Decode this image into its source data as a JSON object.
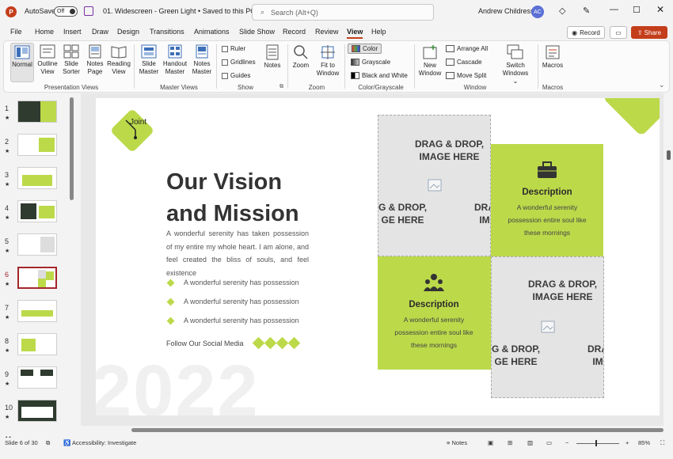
{
  "titlebar": {
    "autosave_label": "AutoSave",
    "autosave_state": "Off",
    "filename": "01. Widescreen - Green Light • Saved to this PC ⌄",
    "search_placeholder": "Search (Alt+Q)",
    "user_name": "Andrew Childress",
    "user_initials": "AC"
  },
  "menu": [
    "File",
    "Home",
    "Insert",
    "Draw",
    "Design",
    "Transitions",
    "Animations",
    "Slide Show",
    "Record",
    "Review",
    "View",
    "Help"
  ],
  "active_menu": "View",
  "actions": {
    "record": "Record",
    "share": "Share"
  },
  "ribbon": {
    "presentation_views": {
      "label": "Presentation Views",
      "buttons": [
        {
          "line1": "Normal",
          "line2": ""
        },
        {
          "line1": "Outline",
          "line2": "View"
        },
        {
          "line1": "Slide",
          "line2": "Sorter"
        },
        {
          "line1": "Notes",
          "line2": "Page"
        },
        {
          "line1": "Reading",
          "line2": "View"
        }
      ]
    },
    "master_views": {
      "label": "Master Views",
      "buttons": [
        {
          "line1": "Slide",
          "line2": "Master"
        },
        {
          "line1": "Handout",
          "line2": "Master"
        },
        {
          "line1": "Notes",
          "line2": "Master"
        }
      ]
    },
    "show": {
      "label": "Show",
      "ruler": "Ruler",
      "gridlines": "Gridlines",
      "guides": "Guides",
      "notes": "Notes"
    },
    "zoom": {
      "label": "Zoom",
      "zoom": "Zoom",
      "fit1": "Fit to",
      "fit2": "Window"
    },
    "color": {
      "label": "Color/Grayscale",
      "color": "Color",
      "grayscale": "Grayscale",
      "bw": "Black and White"
    },
    "window": {
      "label": "Window",
      "new1": "New",
      "new2": "Window",
      "arrange": "Arrange All",
      "cascade": "Cascade",
      "move": "Move Split",
      "switch1": "Switch",
      "switch2": "Windows ⌄"
    },
    "macros": {
      "label": "Macros",
      "macros": "Macros"
    }
  },
  "slides": [
    {
      "num": "1"
    },
    {
      "num": "2"
    },
    {
      "num": "3"
    },
    {
      "num": "4"
    },
    {
      "num": "5"
    },
    {
      "num": "6"
    },
    {
      "num": "7"
    },
    {
      "num": "8"
    },
    {
      "num": "9"
    },
    {
      "num": "10"
    },
    {
      "num": "11"
    }
  ],
  "current_slide": "6",
  "slide": {
    "logo_text": "Joint",
    "title_line1": "Our Vision",
    "title_line2": "and Mission",
    "paragraph": "A wonderful serenity has taken possession of my entire my whole heart. I am alone, and feel created the bliss of souls, and feel existence",
    "bullets": [
      "A wonderful serenity has possession",
      "A wonderful serenity has possession",
      "A wonderful serenity has possession"
    ],
    "follow": "Follow Our Social Media",
    "year": "2022",
    "drag_line1": "DRAG & DROP,",
    "drag_line2": "IMAGE HERE",
    "drag_frag_a1": "G & DROP,",
    "drag_frag_a2": "GE HERE",
    "drag_frag_b1": "DRA",
    "drag_frag_b2": "IM",
    "desc_title": "Description",
    "desc_body1": "A wonderful serenity",
    "desc_body2": "possession entire soul like",
    "desc_body3": "these mornings"
  },
  "status": {
    "slide_of": "Slide 6 of 30",
    "accessibility": "Accessibility: Investigate",
    "notes": "Notes",
    "zoom": "85%"
  },
  "colors": {
    "accent": "#bcd94a",
    "brand": "#c43e1c",
    "selected_slide_border": "#a4262c"
  }
}
